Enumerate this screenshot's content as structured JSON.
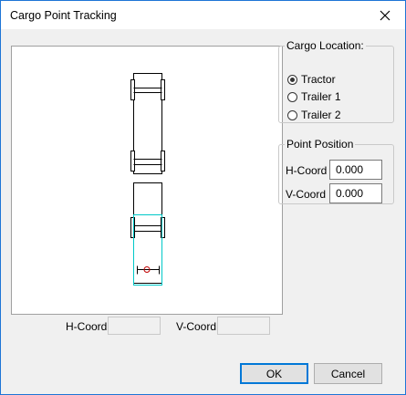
{
  "window": {
    "title": "Cargo Point Tracking"
  },
  "cargo_location": {
    "legend": "Cargo Location:",
    "options": [
      {
        "label": "Tractor",
        "selected": true
      },
      {
        "label": "Trailer 1",
        "selected": false
      },
      {
        "label": "Trailer 2",
        "selected": false
      }
    ]
  },
  "point_position": {
    "legend": "Point Position",
    "h_label": "H-Coord",
    "h_value": "0.000",
    "v_label": "V-Coord",
    "v_value": "0.000"
  },
  "readouts": {
    "h_label": "H-Coord",
    "h_value": "",
    "v_label": "V-Coord",
    "v_value": ""
  },
  "buttons": {
    "ok": "OK",
    "cancel": "Cancel"
  },
  "icons": {
    "close": "close-icon",
    "cargo_point": "cargo-point-marker-icon"
  },
  "colors": {
    "selection_outline": "#00c8c8",
    "cargo_point": "#c00000",
    "window_border": "#1e75d6"
  }
}
